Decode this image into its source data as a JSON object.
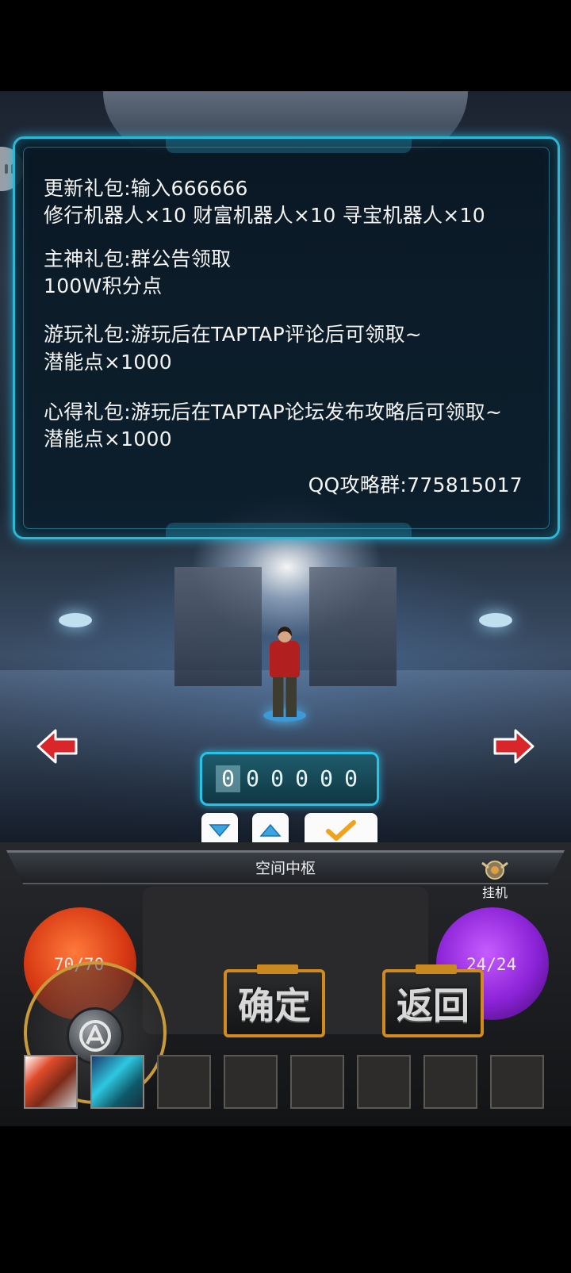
{
  "notice": {
    "line1": "更新礼包:输入666666",
    "line2": "修行机器人×10 财富机器人×10 寻宝机器人×10",
    "line3": "主神礼包:群公告领取",
    "line4": "100W积分点",
    "line5": "游玩礼包:游玩后在TAPTAP评论后可领取~",
    "line6": "潜能点×1000",
    "line7": "心得礼包:游玩后在TAPTAP论坛发布攻略后可领取~",
    "line8": "潜能点×1000",
    "qq": "QQ攻略群:775815017"
  },
  "code_input": {
    "digits": [
      "0",
      "0",
      "0",
      "0",
      "0",
      "0"
    ],
    "active_index": 0
  },
  "bottom": {
    "title": "空间中枢",
    "hang_label": "挂机",
    "hp": "70/70",
    "mp": "24/24",
    "confirm_label": "确定",
    "back_label": "返回"
  },
  "colors": {
    "accent_cyan": "#2bb7d6",
    "button_frame": "#d08a1e",
    "arrow_red": "#d8262b",
    "check_orange": "#f0a21c"
  },
  "icons": [
    "left-arrow-icon",
    "right-arrow-icon",
    "chevron-down-icon",
    "chevron-up-icon",
    "check-icon",
    "hang-icon",
    "pause-icon"
  ]
}
